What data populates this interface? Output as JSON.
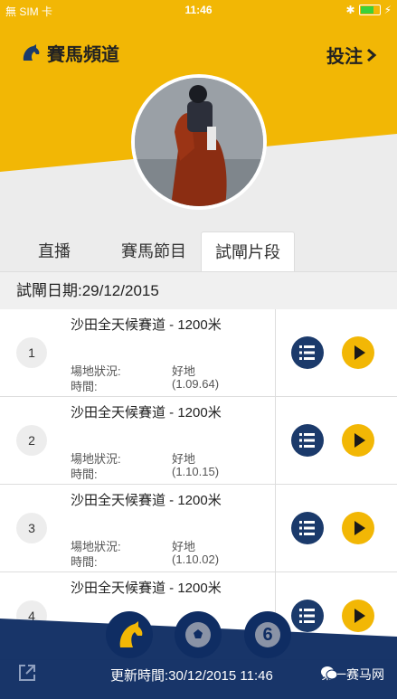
{
  "status": {
    "carrier": "無 SIM 卡",
    "time": "11:46"
  },
  "header": {
    "title": "賽馬頻道",
    "bet_label": "投注"
  },
  "tabs": [
    {
      "label": "直播"
    },
    {
      "label": "賽馬節目"
    },
    {
      "label": "試閘片段"
    }
  ],
  "date_bar": {
    "text": "試閘日期:29/12/2015"
  },
  "rows": [
    {
      "num": "1",
      "track": "沙田全天候賽道 - 1200米",
      "cond_label": "場地狀況:",
      "cond_value": "好地",
      "time_label": "時間:",
      "time_value": "(1.09.64)"
    },
    {
      "num": "2",
      "track": "沙田全天候賽道 - 1200米",
      "cond_label": "場地狀況:",
      "cond_value": "好地",
      "time_label": "時間:",
      "time_value": "(1.10.15)"
    },
    {
      "num": "3",
      "track": "沙田全天候賽道 - 1200米",
      "cond_label": "場地狀況:",
      "cond_value": "好地",
      "time_label": "時間:",
      "time_value": "(1.10.02)"
    },
    {
      "num": "4",
      "track": "沙田全天候賽道 - 1200米",
      "cond_label": "",
      "cond_value": "",
      "time_label": "",
      "time_value": ""
    }
  ],
  "footer": {
    "update_text": "更新時間:30/12/2015 11:46",
    "watermark": "第一赛马网",
    "six_label": "6"
  },
  "colors": {
    "yellow": "#f2b705",
    "navy": "#1b3a6b",
    "footer_navy": "#0f2d63"
  },
  "icons": [
    "horse-logo-icon",
    "chevron-right-icon",
    "list-icon",
    "play-icon",
    "soccer-icon",
    "share-icon",
    "wechat-icon"
  ]
}
